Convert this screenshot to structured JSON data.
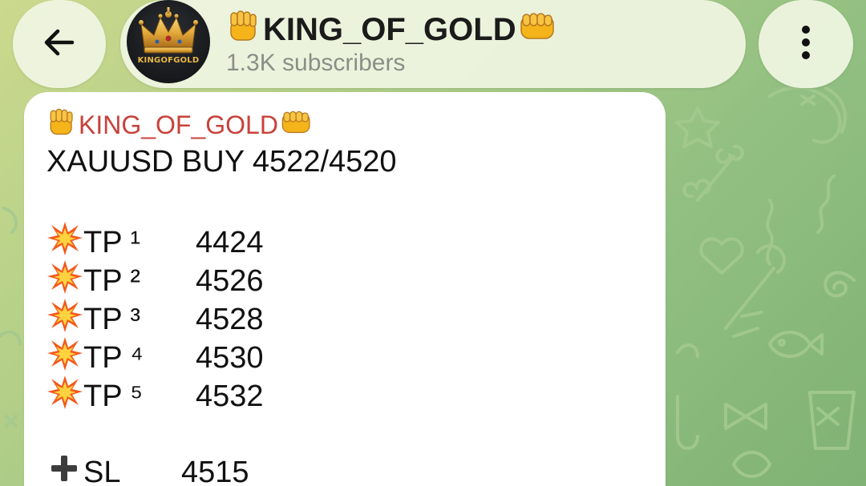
{
  "header": {
    "back_icon": "arrow-left-icon",
    "channel_name": "KING_OF_GOLD",
    "subscribers": "1.3K subscribers",
    "avatar_text": "KINGOFGOLD",
    "menu_icon": "more-vertical-icon",
    "name_prefix_icon": "raised-fist-icon",
    "name_suffix_icon": "oncoming-fist-icon"
  },
  "message": {
    "sender": "KING_OF_GOLD",
    "signal": "XAUUSD BUY 4522/4520",
    "targets": [
      {
        "label": "TP ¹",
        "value": "4424"
      },
      {
        "label": "TP ²",
        "value": "4526"
      },
      {
        "label": "TP ³",
        "value": "4528"
      },
      {
        "label": "TP ⁴",
        "value": "4530"
      },
      {
        "label": "TP ⁵",
        "value": "4532"
      }
    ],
    "target_icon": "collision-icon",
    "stop_loss": {
      "label": "SL",
      "value": "4515"
    },
    "stop_loss_icon": "plus-icon"
  },
  "colors": {
    "sender": "#c7423b",
    "wallpaper": "#92c082",
    "pill_bg": "#f0f5e2",
    "avatar_gold": "#e9b646"
  }
}
